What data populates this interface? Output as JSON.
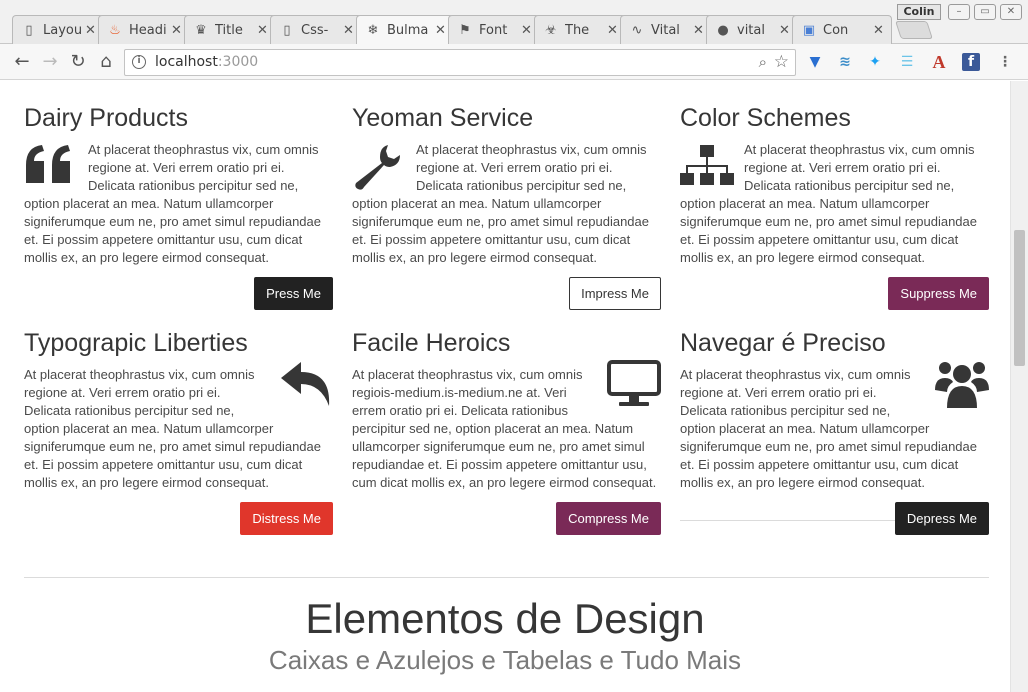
{
  "browser": {
    "tabs": [
      {
        "label": "Layout",
        "icon": "document-icon",
        "glyph": "🗋"
      },
      {
        "label": "Heading",
        "icon": "flame-icon",
        "glyph": "🔥"
      },
      {
        "label": "Title",
        "icon": "cupcake-icon",
        "glyph": "🧁"
      },
      {
        "label": "Css-",
        "icon": "document-icon",
        "glyph": "🗋"
      },
      {
        "label": "Bulma",
        "icon": "snowflake-icon",
        "glyph": "❄"
      },
      {
        "label": "Font",
        "icon": "flag-icon",
        "glyph": "⚑"
      },
      {
        "label": "The",
        "icon": "biohazard-icon",
        "glyph": "☣"
      },
      {
        "label": "Vital",
        "icon": "pulse-icon",
        "glyph": "∿"
      },
      {
        "label": "vital",
        "icon": "github-icon",
        "glyph": "●"
      },
      {
        "label": "Con",
        "icon": "chat-icon",
        "glyph": "▣"
      }
    ],
    "profile_name": "Colin",
    "url_host": "localhost",
    "url_port": ":3000"
  },
  "cards": [
    {
      "title": "Dairy Products",
      "text": "At placerat theophrastus vix, cum omnis regione at. Veri errem oratio pri ei. Delicata rationibus percipitur sed ne, option placerat an mea. Natum ullamcorper signiferumque eum ne, pro amet simul repudiandae et. Ei possim appetere omittantur usu, cum dicat mollis ex, an pro legere eirmod consequat.",
      "button": "Press Me",
      "icon": "quote-icon"
    },
    {
      "title": "Yeoman Service",
      "text": "At placerat theophrastus vix, cum omnis regione at. Veri errem oratio pri ei. Delicata rationibus percipitur sed ne, option placerat an mea. Natum ullamcorper signiferumque eum ne, pro amet simul repudiandae et. Ei possim appetere omittantur usu, cum dicat mollis ex, an pro legere eirmod consequat.",
      "button": "Impress Me",
      "icon": "wrench-icon"
    },
    {
      "title": "Color Schemes",
      "text": "At placerat theophrastus vix, cum omnis regione at. Veri errem oratio pri ei. Delicata rationibus percipitur sed ne, option placerat an mea. Natum ullamcorper signiferumque eum ne, pro amet simul repudiandae et. Ei possim appetere omittantur usu, cum dicat mollis ex, an pro legere eirmod consequat.",
      "button": "Suppress Me",
      "icon": "sitemap-icon"
    },
    {
      "title": "Typograpic Liberties",
      "text": "At placerat theophrastus vix, cum omnis regione at. Veri errem oratio pri ei. Delicata rationibus percipitur sed ne, option placerat an mea. Natum ullamcorper signiferumque eum ne, pro amet simul repudiandae et. Ei possim appetere omittantur usu, cum dicat mollis ex, an pro legere eirmod consequat.",
      "button": "Distress Me",
      "icon": "reply-icon"
    },
    {
      "title": "Facile Heroics",
      "text": "At placerat theophrastus vix, cum omnis regiois-medium.is-medium.ne at. Veri errem oratio pri ei. Delicata rationibus percipitur sed ne, option placerat an mea. Natum ullamcorper signiferumque eum ne, pro amet simul repudiandae et. Ei possim appetere omittantur usu, cum dicat mollis ex, an pro legere eirmod consequat.",
      "button": "Compress Me",
      "icon": "monitor-icon"
    },
    {
      "title": "Navegar é Preciso",
      "text": "At placerat theophrastus vix, cum omnis regione at. Veri errem oratio pri ei. Delicata rationibus percipitur sed ne, option placerat an mea. Natum ullamcorper signiferumque eum ne, pro amet simul repudiandae et. Ei possim appetere omittantur usu, cum dicat mollis ex, an pro legere eirmod consequat.",
      "button": "Depress Me",
      "icon": "users-icon"
    }
  ],
  "section": {
    "title": "Elementos de Design",
    "subtitle": "Caixas e Azulejos e Tabelas e Tudo Mais"
  },
  "colors": {
    "dark_button": "#222222",
    "purple_button": "#7a2a57",
    "red_button": "#e0362b"
  }
}
